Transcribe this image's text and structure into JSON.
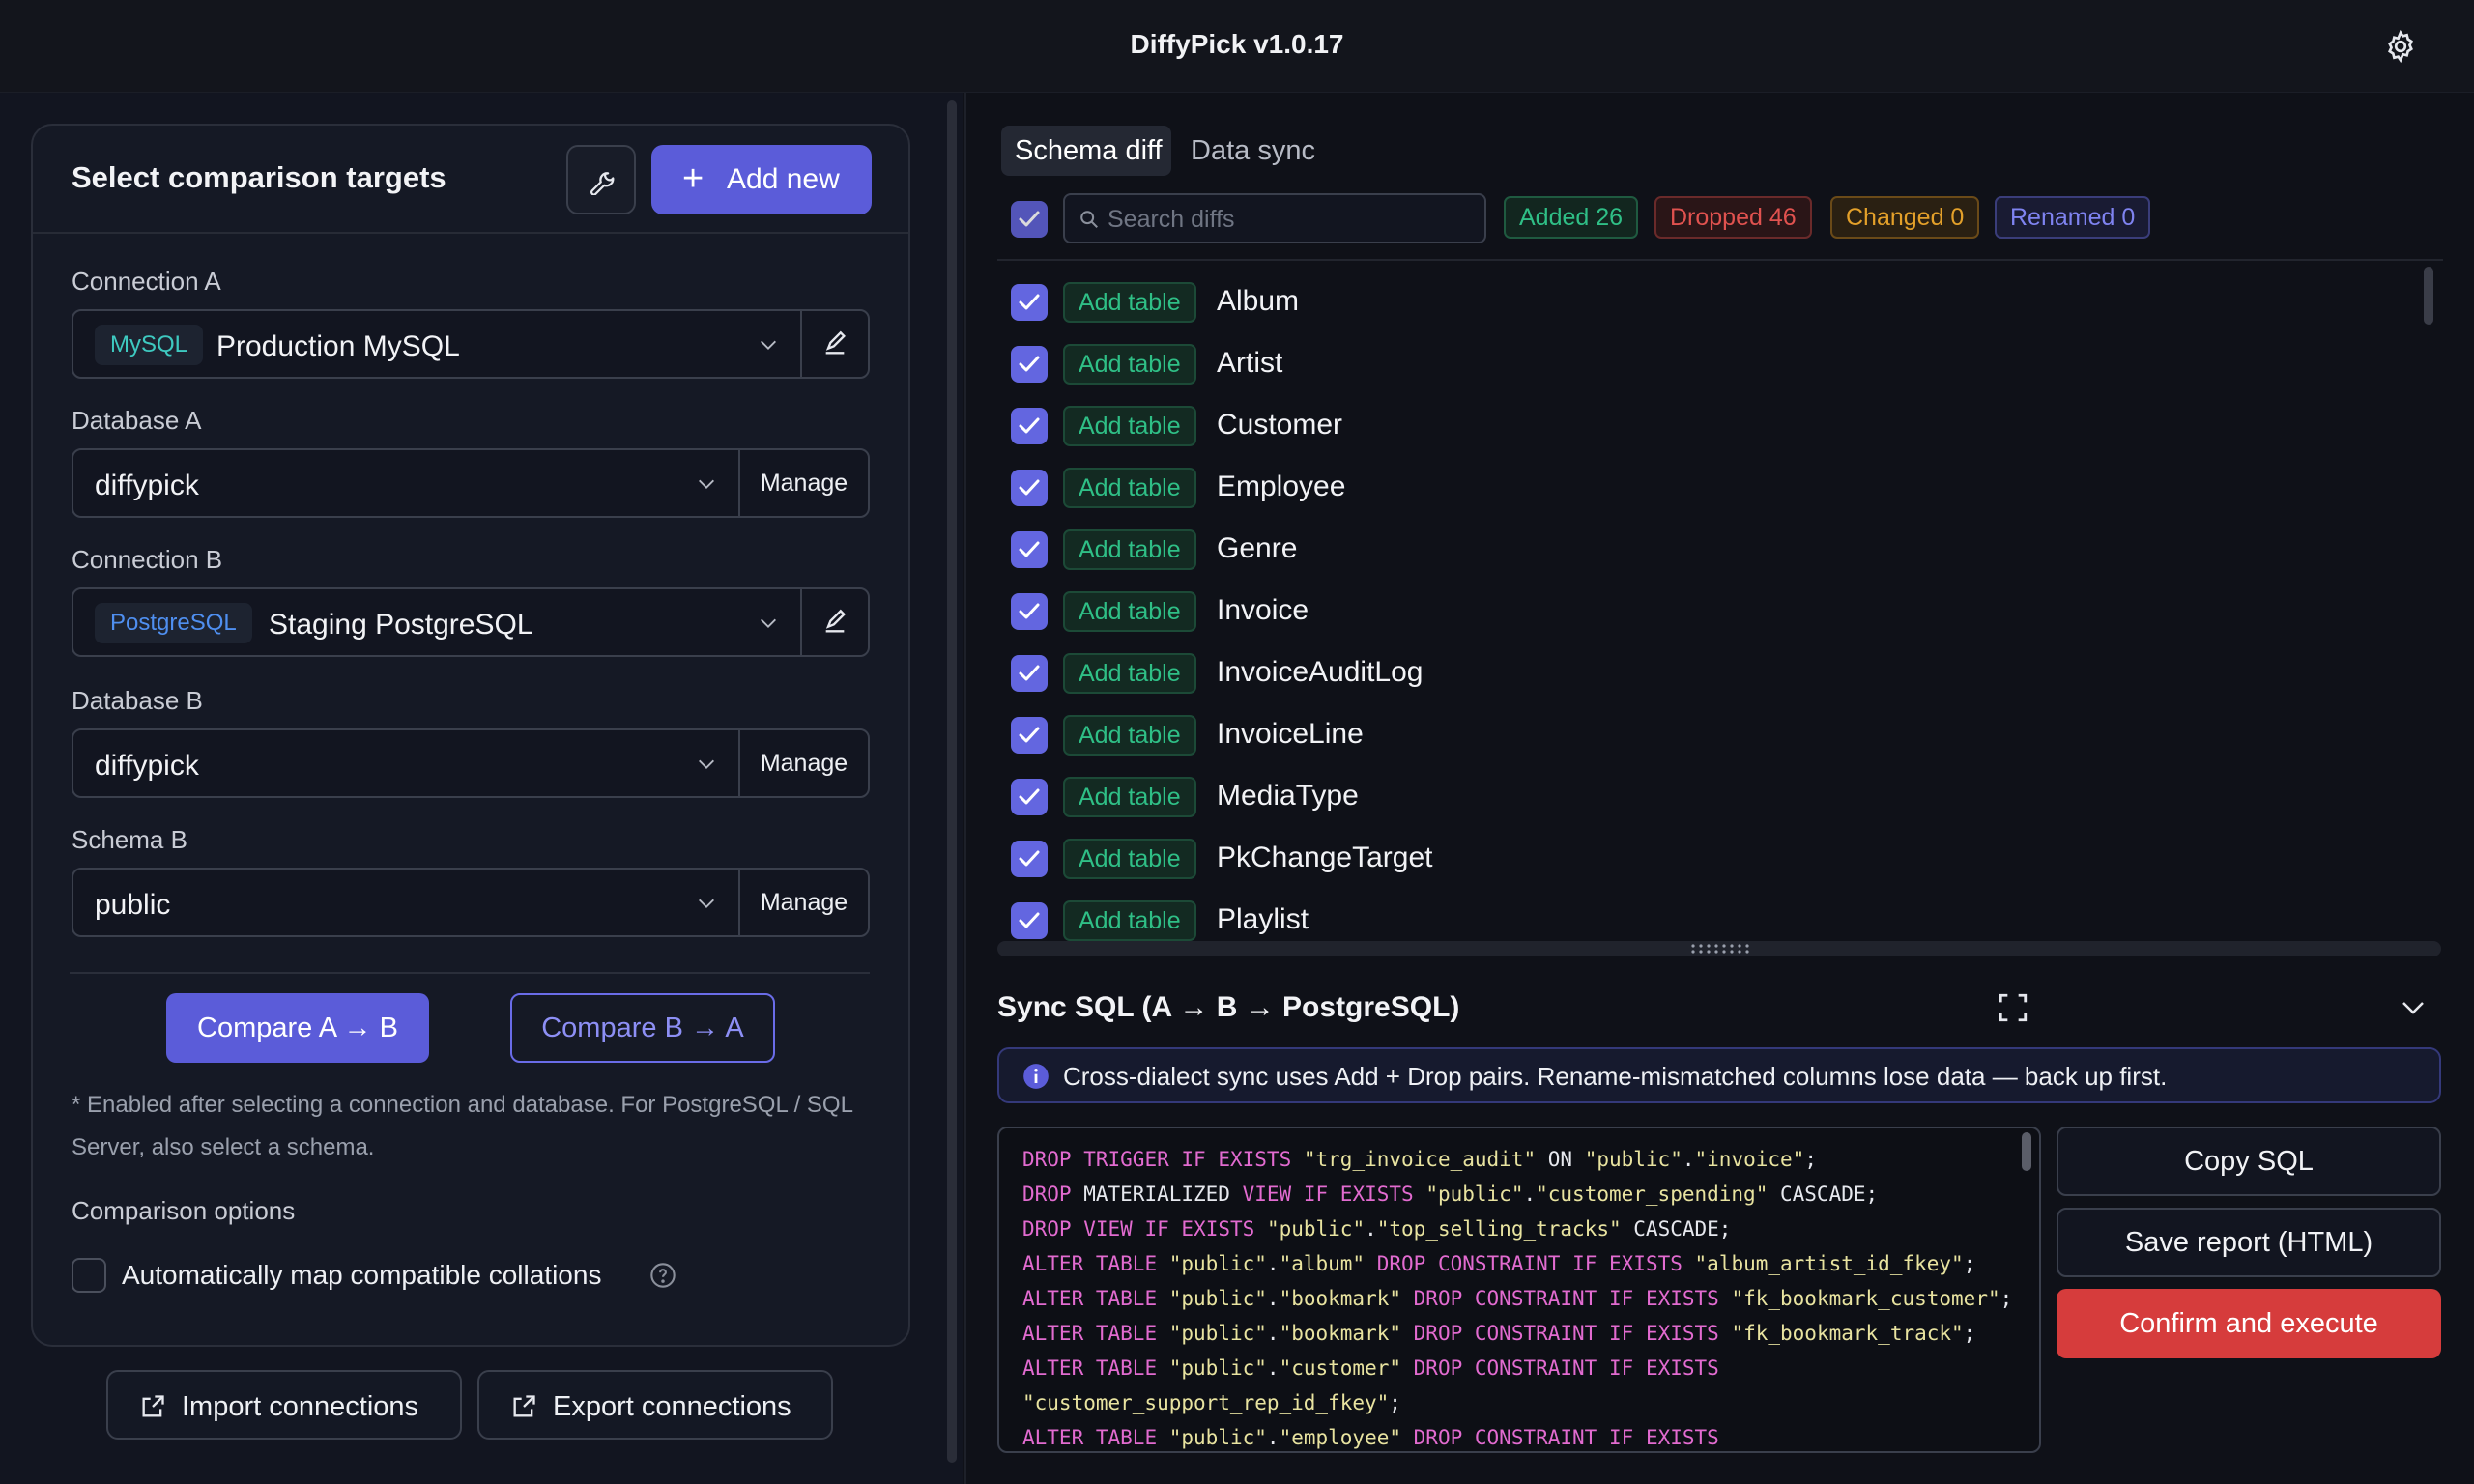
{
  "app": {
    "title": "DiffyPick v1.0.17"
  },
  "left": {
    "card_title": "Select comparison targets",
    "add_new_label": "Add new",
    "connection_a": {
      "label": "Connection A",
      "tag": "MySQL",
      "value": "Production MySQL"
    },
    "database_a": {
      "label": "Database A",
      "value": "diffypick",
      "manage": "Manage"
    },
    "connection_b": {
      "label": "Connection B",
      "tag": "PostgreSQL",
      "value": "Staging PostgreSQL"
    },
    "database_b": {
      "label": "Database B",
      "value": "diffypick",
      "manage": "Manage"
    },
    "schema_b": {
      "label": "Schema B",
      "value": "public",
      "manage": "Manage"
    },
    "compare_a_b": "Compare A → B",
    "compare_b_a": "Compare B → A",
    "note": "* Enabled after selecting a connection and database. For PostgreSQL / SQL Server, also select a schema.",
    "options_title": "Comparison options",
    "auto_map_label": "Automatically map compatible collations",
    "import_label": "Import connections",
    "export_label": "Export connections"
  },
  "right": {
    "tabs": [
      "Schema diff",
      "Data sync"
    ],
    "search_placeholder": "Search diffs",
    "stats": {
      "added": "Added 26",
      "dropped": "Dropped 46",
      "changed": "Changed 0",
      "renamed": "Renamed 0"
    },
    "rows": [
      {
        "tag": "Add table",
        "name": "Album"
      },
      {
        "tag": "Add table",
        "name": "Artist"
      },
      {
        "tag": "Add table",
        "name": "Customer"
      },
      {
        "tag": "Add table",
        "name": "Employee"
      },
      {
        "tag": "Add table",
        "name": "Genre"
      },
      {
        "tag": "Add table",
        "name": "Invoice"
      },
      {
        "tag": "Add table",
        "name": "InvoiceAuditLog"
      },
      {
        "tag": "Add table",
        "name": "InvoiceLine"
      },
      {
        "tag": "Add table",
        "name": "MediaType"
      },
      {
        "tag": "Add table",
        "name": "PkChangeTarget"
      },
      {
        "tag": "Add table",
        "name": "Playlist"
      }
    ],
    "sync_title": "Sync SQL (A → B → PostgreSQL)",
    "info_text": "Cross-dialect sync uses Add + Drop pairs. Rename-mismatched columns lose data — back up first.",
    "sql_lines": [
      "DROP TRIGGER IF EXISTS \"trg_invoice_audit\" ON \"public\".\"invoice\";",
      "DROP MATERIALIZED VIEW IF EXISTS \"public\".\"customer_spending\" CASCADE;",
      "DROP VIEW IF EXISTS \"public\".\"top_selling_tracks\" CASCADE;",
      "ALTER TABLE \"public\".\"album\" DROP CONSTRAINT IF EXISTS \"album_artist_id_fkey\";",
      "ALTER TABLE \"public\".\"bookmark\" DROP CONSTRAINT IF EXISTS \"fk_bookmark_customer\";",
      "ALTER TABLE \"public\".\"bookmark\" DROP CONSTRAINT IF EXISTS \"fk_bookmark_track\";",
      "ALTER TABLE \"public\".\"customer\" DROP CONSTRAINT IF EXISTS",
      "\"customer_support_rep_id_fkey\";",
      "ALTER TABLE \"public\".\"employee\" DROP CONSTRAINT IF EXISTS"
    ],
    "copy_sql": "Copy SQL",
    "save_report": "Save report (HTML)",
    "confirm_execute": "Confirm and execute"
  },
  "colors": {
    "accent": "#5b5cd9",
    "added": "#2fbf86",
    "dropped": "#e0524f",
    "changed": "#e3a02a",
    "renamed": "#7f83f0",
    "danger": "#d63c3c"
  }
}
